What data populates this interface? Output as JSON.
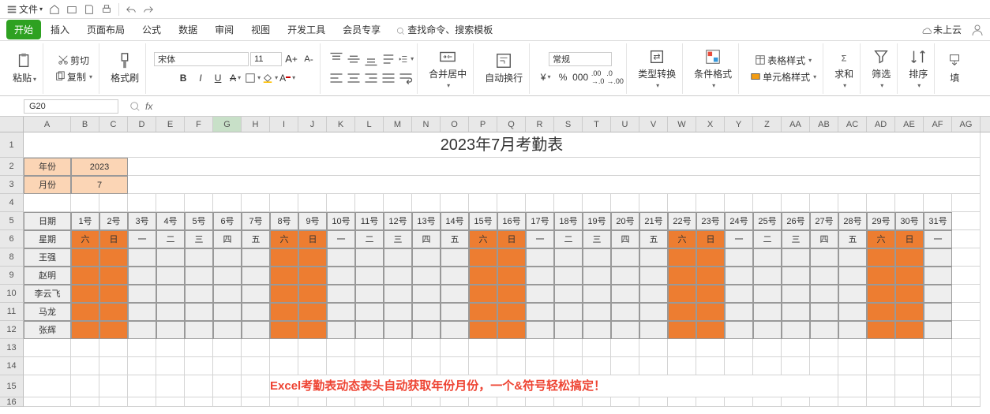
{
  "titlebar": {
    "file": "文件",
    "cloud": "未上云"
  },
  "menu": {
    "tabs": [
      "开始",
      "插入",
      "页面布局",
      "公式",
      "数据",
      "审阅",
      "视图",
      "开发工具",
      "会员专享"
    ],
    "active": 0,
    "search": "查找命令、搜索模板"
  },
  "ribbon": {
    "paste": "粘贴",
    "cut": "剪切",
    "copy": "复制",
    "fmt": "格式刷",
    "font": "宋体",
    "size": "11",
    "merge": "合并居中",
    "wrap": "自动换行",
    "numfmt": "常规",
    "typeconv": "类型转换",
    "cond": "条件格式",
    "tblstyle": "表格样式",
    "cellstyle": "单元格样式",
    "sum": "求和",
    "filter": "筛选",
    "sort": "排序",
    "fill": "填"
  },
  "namebox": "G20",
  "sheet": {
    "cols": [
      "A",
      "B",
      "C",
      "D",
      "E",
      "F",
      "G",
      "H",
      "I",
      "J",
      "K",
      "L",
      "M",
      "N",
      "O",
      "P",
      "Q",
      "R",
      "S",
      "T",
      "U",
      "V",
      "W",
      "X",
      "Y",
      "Z",
      "AA",
      "AB",
      "AC",
      "AD",
      "AE",
      "AF",
      "AG"
    ],
    "selcol": 6,
    "title": "2023年7月考勤表",
    "yearLbl": "年份",
    "year": "2023",
    "monthLbl": "月份",
    "month": "7",
    "dateLbl": "日期",
    "weekLbl": "星期",
    "dates": [
      "1号",
      "2号",
      "3号",
      "4号",
      "5号",
      "6号",
      "7号",
      "8号",
      "9号",
      "10号",
      "11号",
      "12号",
      "13号",
      "14号",
      "15号",
      "16号",
      "17号",
      "18号",
      "19号",
      "20号",
      "21号",
      "22号",
      "23号",
      "24号",
      "25号",
      "26号",
      "27号",
      "28号",
      "29号",
      "30号",
      "31号"
    ],
    "week": [
      "六",
      "日",
      "一",
      "二",
      "三",
      "四",
      "五",
      "六",
      "日",
      "一",
      "二",
      "三",
      "四",
      "五",
      "六",
      "日",
      "一",
      "二",
      "三",
      "四",
      "五",
      "六",
      "日",
      "一",
      "二",
      "三",
      "四",
      "五",
      "六",
      "日",
      "一"
    ],
    "weekend": [
      0,
      1,
      7,
      8,
      14,
      15,
      21,
      22,
      28,
      29
    ],
    "names": [
      "王强",
      "赵明",
      "李云飞",
      "马龙",
      "张辉"
    ],
    "rownums": [
      1,
      2,
      3,
      4,
      5,
      6,
      8,
      9,
      10,
      11,
      12,
      13,
      14,
      15,
      16
    ],
    "footer": "Excel考勤表动态表头自动获取年份月份，一个&符号轻松搞定！"
  }
}
